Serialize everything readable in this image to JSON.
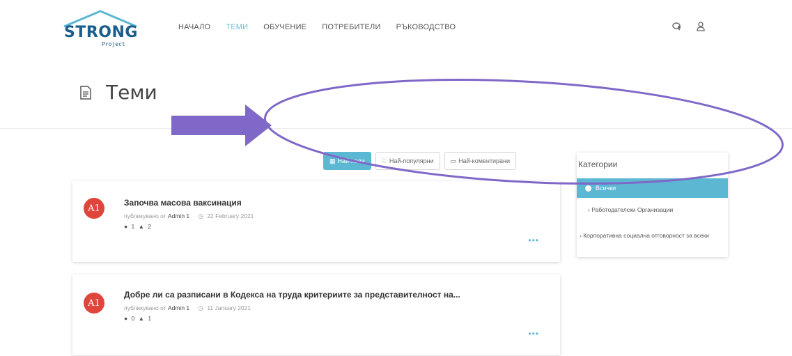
{
  "brand": {
    "name": "STRONG",
    "sub": "Project"
  },
  "nav": {
    "items": [
      {
        "label": "НАЧАЛО",
        "active": false
      },
      {
        "label": "ТЕМИ",
        "active": true
      },
      {
        "label": "ОБУЧЕНИЕ",
        "active": false
      },
      {
        "label": "ПОТРЕБИТЕЛИ",
        "active": false
      },
      {
        "label": "РЪКОВОДСТВО",
        "active": false
      }
    ]
  },
  "header_icons": [
    "chat-icon",
    "user-icon"
  ],
  "page": {
    "title": "Теми",
    "icon": "document-icon"
  },
  "filters": [
    {
      "label": "Най-нови",
      "icon": "calendar-icon",
      "active": true
    },
    {
      "label": "Най-популярни",
      "icon": "thumbs-up-icon",
      "active": false
    },
    {
      "label": "Най-коментирани",
      "icon": "comment-icon",
      "active": false
    }
  ],
  "topics": [
    {
      "avatar": "A1",
      "title": "Започва масова ваксинация",
      "posted_by_prefix": "публикувано от",
      "author": "Admin 1",
      "date": "22 February 2021",
      "comments": "1",
      "likes": "2",
      "more": "•••"
    },
    {
      "avatar": "A1",
      "title": "Добре ли са разписани в Кодекса на труда критериите за представителност на...",
      "posted_by_prefix": "публикувано от",
      "author": "Admin 1",
      "date": "11 January 2021",
      "comments": "0",
      "likes": "1",
      "more": "•••"
    }
  ],
  "categories": {
    "title": "Категории",
    "items": [
      {
        "label": "Всички",
        "active": true
      },
      {
        "label": "Работодателски Организации",
        "active": false
      },
      {
        "label": "Корпоративна социална отговорност за всеки",
        "active": false
      }
    ]
  },
  "colors": {
    "accent": "#5cb7d2",
    "brand": "#1b5d8c",
    "avatar": "#e0453c",
    "annotation": "#8068c8"
  }
}
